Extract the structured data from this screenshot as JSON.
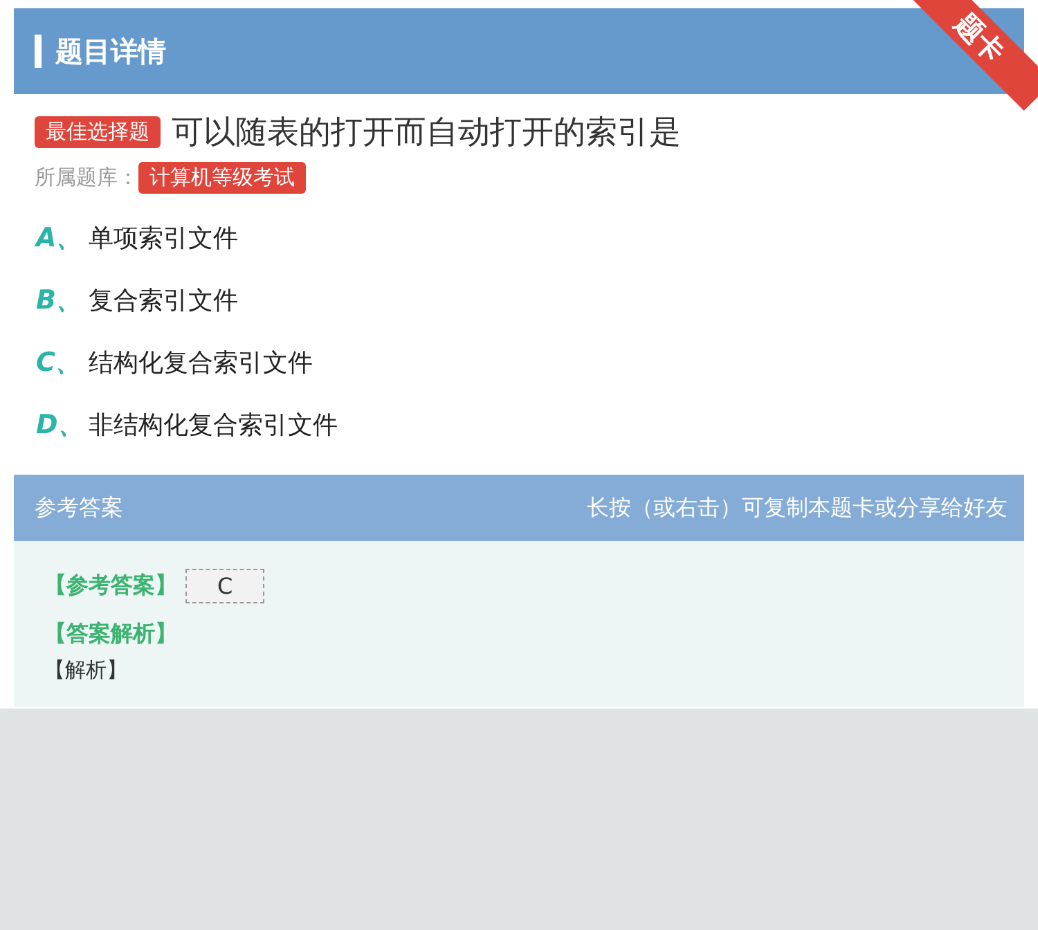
{
  "header": {
    "title": "题目详情",
    "ribbon": "题卡"
  },
  "question": {
    "type_badge": "最佳选择题",
    "text": "可以随表的打开而自动打开的索引是",
    "bank_label": "所属题库：",
    "bank_badge": "计算机等级考试"
  },
  "options": [
    {
      "letter": "A、",
      "text": "单项索引文件"
    },
    {
      "letter": "B、",
      "text": "复合索引文件"
    },
    {
      "letter": "C、",
      "text": "结构化复合索引文件"
    },
    {
      "letter": "D、",
      "text": "非结构化复合索引文件"
    }
  ],
  "answer_bar": {
    "title": "参考答案",
    "hint": "长按（或右击）可复制本题卡或分享给好友"
  },
  "answer": {
    "label": "【参考答案】",
    "value": "C",
    "analysis_label": "【答案解析】",
    "analysis_text": "【解析】"
  }
}
